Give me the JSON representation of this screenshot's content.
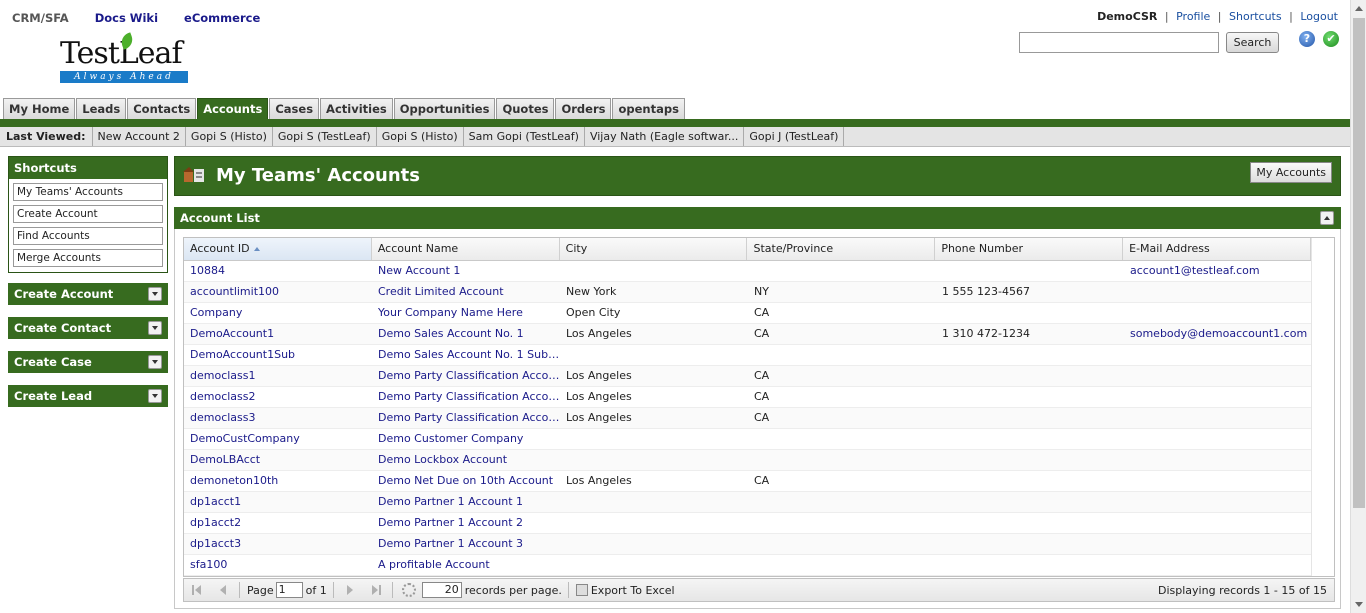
{
  "topnav": {
    "crm": "CRM/SFA",
    "docs": "Docs Wiki",
    "ecommerce": "eCommerce"
  },
  "logo": {
    "word": "TestLeaf",
    "tagline": "Always Ahead"
  },
  "userbar": {
    "user": "DemoCSR",
    "profile": "Profile",
    "shortcuts": "Shortcuts",
    "logout": "Logout",
    "sep": "|"
  },
  "search": {
    "value": "",
    "button": "Search"
  },
  "icons": {
    "help": "?",
    "ok": "✔"
  },
  "tabs": [
    "My Home",
    "Leads",
    "Contacts",
    "Accounts",
    "Cases",
    "Activities",
    "Opportunities",
    "Quotes",
    "Orders",
    "opentaps"
  ],
  "active_tab": "Accounts",
  "last_viewed": {
    "label": "Last Viewed:",
    "items": [
      "New Account 2",
      "Gopi S (Histo)",
      "Gopi S (TestLeaf)",
      "Gopi S (Histo)",
      "Sam Gopi (TestLeaf)",
      "Vijay Nath (Eagle softwar...",
      "Gopi J (TestLeaf)"
    ]
  },
  "sidebar": {
    "shortcuts_title": "Shortcuts",
    "shortcuts": [
      "My Teams' Accounts",
      "Create Account",
      "Find Accounts",
      "Merge Accounts"
    ],
    "quick": [
      "Create Account",
      "Create Contact",
      "Create Case",
      "Create Lead"
    ]
  },
  "main": {
    "title": "My Teams' Accounts",
    "my_accounts_button": "My Accounts",
    "list_title": "Account List"
  },
  "grid": {
    "columns": [
      "Account ID",
      "Account Name",
      "City",
      "State/Province",
      "Phone Number",
      "E-Mail Address"
    ],
    "rows": [
      [
        "10884",
        "New Account 1",
        "",
        "",
        "",
        "account1@testleaf.com"
      ],
      [
        "accountlimit100",
        "Credit Limited Account",
        "New York",
        "NY",
        "1 555 123-4567",
        ""
      ],
      [
        "Company",
        "Your Company Name Here",
        "Open City",
        "CA",
        "",
        ""
      ],
      [
        "DemoAccount1",
        "Demo Sales Account No. 1",
        "Los Angeles",
        "CA",
        "1 310 472-1234",
        "somebody@demoaccount1.com"
      ],
      [
        "DemoAccount1Sub",
        "Demo Sales Account No. 1 Subsi...",
        "",
        "",
        "",
        ""
      ],
      [
        "democlass1",
        "Demo Party Classification Accou...",
        "Los Angeles",
        "CA",
        "",
        ""
      ],
      [
        "democlass2",
        "Demo Party Classification Accou...",
        "Los Angeles",
        "CA",
        "",
        ""
      ],
      [
        "democlass3",
        "Demo Party Classification Accou...",
        "Los Angeles",
        "CA",
        "",
        ""
      ],
      [
        "DemoCustCompany",
        "Demo Customer Company",
        "",
        "",
        "",
        ""
      ],
      [
        "DemoLBAcct",
        "Demo Lockbox Account",
        "",
        "",
        "",
        ""
      ],
      [
        "demoneton10th",
        "Demo Net Due on 10th Account",
        "Los Angeles",
        "CA",
        "",
        ""
      ],
      [
        "dp1acct1",
        "Demo Partner 1 Account 1",
        "",
        "",
        "",
        ""
      ],
      [
        "dp1acct2",
        "Demo Partner 1 Account 2",
        "",
        "",
        "",
        ""
      ],
      [
        "dp1acct3",
        "Demo Partner 1 Account 3",
        "",
        "",
        "",
        ""
      ],
      [
        "sfa100",
        "A profitable Account",
        "",
        "",
        "",
        ""
      ]
    ]
  },
  "pager": {
    "page_label": "Page",
    "page_value": "1",
    "of_label": "of 1",
    "rpp_value": "20",
    "rpp_label": "records per page.",
    "export": "Export To Excel",
    "display": "Displaying records 1 - 15 of 15"
  },
  "colors": {
    "brand_green": "#376b1f",
    "link_blue": "#1a1a8a"
  }
}
